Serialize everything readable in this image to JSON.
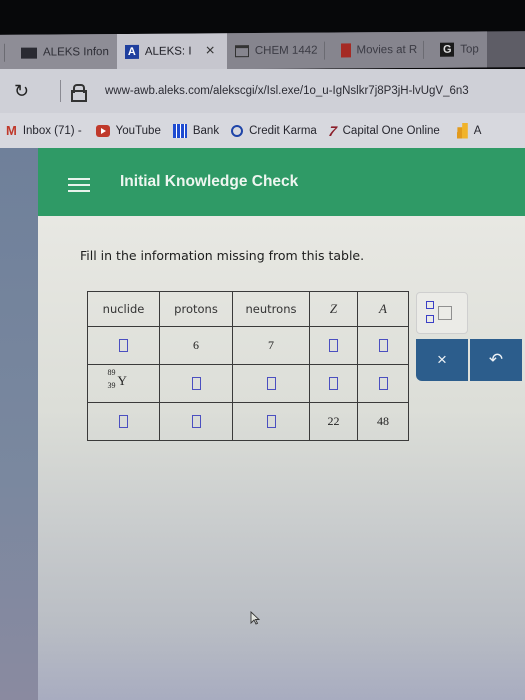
{
  "browser": {
    "tabs": [
      {
        "label": "ALEKS Infon",
        "icon": "aleks-info-icon",
        "active": false
      },
      {
        "label": "ALEKS: I",
        "icon": "aleks-icon",
        "active": true,
        "close": "×"
      },
      {
        "label": "CHEM 1442",
        "icon": "window-icon",
        "active": false
      },
      {
        "label": "Movies at R",
        "icon": "movies-icon",
        "active": false
      },
      {
        "label": "Top",
        "icon": "g-icon",
        "active": false
      }
    ],
    "url": "www-awb.aleks.com/alekscgi/x/Isl.exe/1o_u-IgNslkr7j8P3jH-lvUgV_6n3",
    "bookmarks": [
      {
        "label": "Inbox (71) -",
        "icon": "gmail-icon"
      },
      {
        "label": "YouTube",
        "icon": "youtube-icon"
      },
      {
        "label": "Bank",
        "icon": "bank-icon"
      },
      {
        "label": "Credit Karma",
        "icon": "credit-karma-icon"
      },
      {
        "label": "Capital One Online",
        "icon": "capital-one-icon"
      },
      {
        "label": "A",
        "icon": "analytics-icon"
      }
    ]
  },
  "app": {
    "title": "Initial Knowledge Check",
    "brand_color": "#2f9a66",
    "prompt": "Fill in the information missing from this table."
  },
  "table": {
    "headers": [
      "nuclide",
      "protons",
      "neutrons",
      "Z",
      "A"
    ],
    "rows": [
      {
        "nuclide": null,
        "protons": "6",
        "neutrons": "7",
        "Z": null,
        "A": null
      },
      {
        "nuclide": {
          "symbol": "Y",
          "mass": "89",
          "atomic": "39"
        },
        "protons": null,
        "neutrons": null,
        "Z": null,
        "A": null
      },
      {
        "nuclide": null,
        "protons": null,
        "neutrons": null,
        "Z": "22",
        "A": "48"
      }
    ]
  },
  "toolbar": {
    "palette_icon": "superscript-subscript-template-icon",
    "clear_label": "×",
    "undo_label": "↶",
    "button_color": "#2c5d8c"
  }
}
